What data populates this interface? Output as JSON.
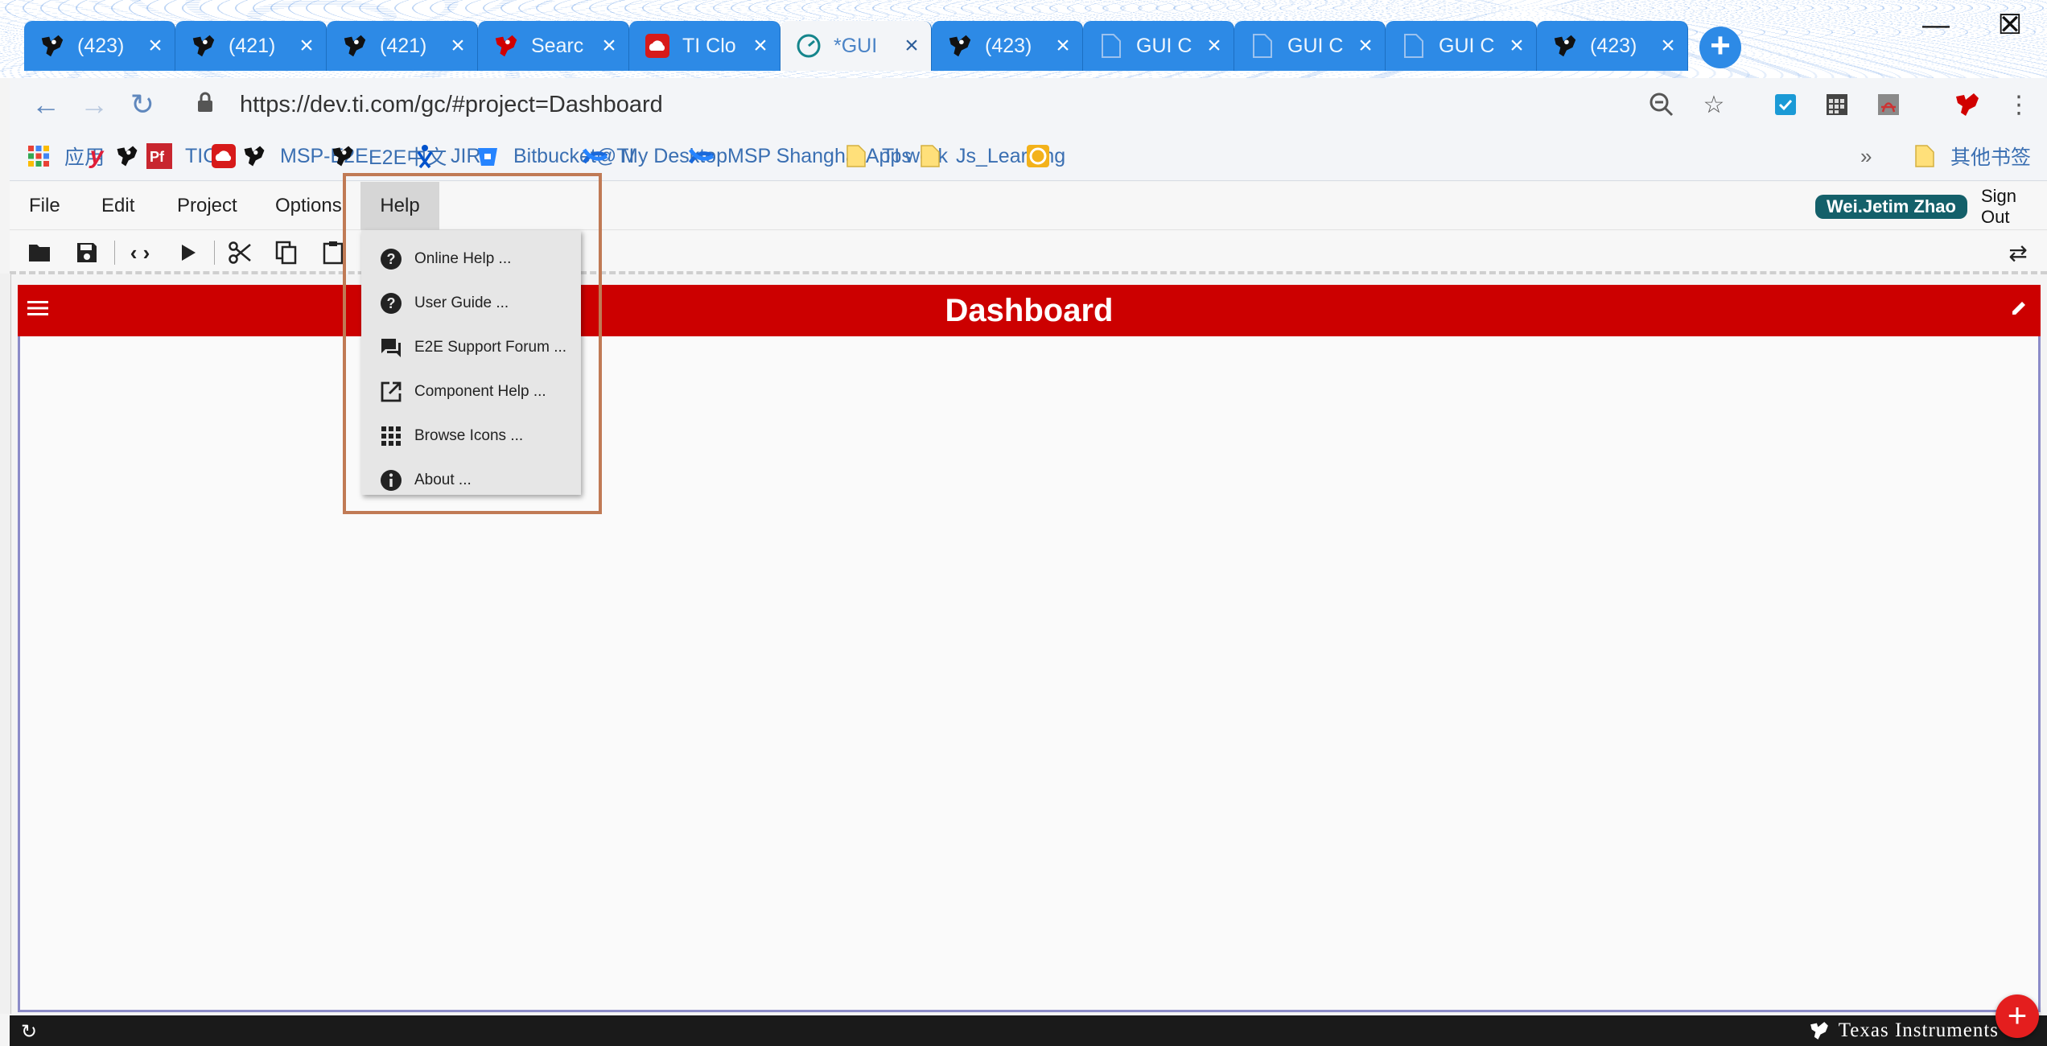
{
  "browser": {
    "tabs": [
      {
        "title": "(423)",
        "icon": "ti-logo-icon",
        "active": false
      },
      {
        "title": "(421)",
        "icon": "ti-logo-icon",
        "active": false
      },
      {
        "title": "(421)",
        "icon": "ti-logo-icon",
        "active": false
      },
      {
        "title": "Searc",
        "icon": "ti-red-logo-icon",
        "active": false
      },
      {
        "title": "TI Clo",
        "icon": "ti-cloud-icon",
        "active": false
      },
      {
        "title": "*GUI",
        "icon": "gui-composer-icon",
        "active": true
      },
      {
        "title": "(423)",
        "icon": "ti-logo-icon",
        "active": false
      },
      {
        "title": "GUI C",
        "icon": "document-icon",
        "active": false
      },
      {
        "title": "GUI C",
        "icon": "document-icon",
        "active": false
      },
      {
        "title": "GUI C",
        "icon": "document-icon",
        "active": false
      },
      {
        "title": "(423)",
        "icon": "ti-logo-icon",
        "active": false
      }
    ],
    "url": "https://dev.ti.com/gc/#project=Dashboard",
    "bookmarks": [
      {
        "label": "应用",
        "icon": "apps-grid-icon"
      },
      {
        "label": "",
        "icon": "y-logo-icon"
      },
      {
        "label": "",
        "icon": "ti-logo-icon"
      },
      {
        "label": "TICA",
        "icon": "pf-logo-icon"
      },
      {
        "label": "",
        "icon": "ti-cloud-icon"
      },
      {
        "label": "MSP-E2E",
        "icon": "ti-logo-icon"
      },
      {
        "label": "E2E中文",
        "icon": "ti-logo-icon"
      },
      {
        "label": "JIRA",
        "icon": "jira-icon"
      },
      {
        "label": "Bitbucket@TI",
        "icon": "bitbucket-icon"
      },
      {
        "label": "My Desktop",
        "icon": "confluence-icon"
      },
      {
        "label": "MSP Shanghai Apps",
        "icon": "confluence-icon"
      },
      {
        "label": "TI work",
        "icon": "folder-icon"
      },
      {
        "label": "Js_Learning",
        "icon": "folder-icon"
      },
      {
        "label": "",
        "icon": "coin-icon"
      }
    ],
    "more_bookmarks": "»",
    "other_bookmarks": "其他书签"
  },
  "app": {
    "menus": [
      "File",
      "Edit",
      "Project",
      "Options",
      "Help"
    ],
    "user": "Wei.Jetim Zhao",
    "sign_out": "Sign Out",
    "dashboard_title": "Dashboard",
    "help_menu": [
      {
        "label": "Online Help ...",
        "icon": "help-circle-icon"
      },
      {
        "label": "User Guide ...",
        "icon": "help-circle-icon"
      },
      {
        "label": "E2E Support Forum ...",
        "icon": "forum-icon"
      },
      {
        "label": "Component Help ...",
        "icon": "open-in-new-icon"
      },
      {
        "label": "Browse Icons ...",
        "icon": "apps-grid-icon"
      },
      {
        "label": "About ...",
        "icon": "info-icon"
      }
    ],
    "brand": "Texas Instruments",
    "colors": {
      "header": "#cc0000",
      "tab_blue": "#2d8ae6",
      "user_badge": "#14606a"
    }
  }
}
